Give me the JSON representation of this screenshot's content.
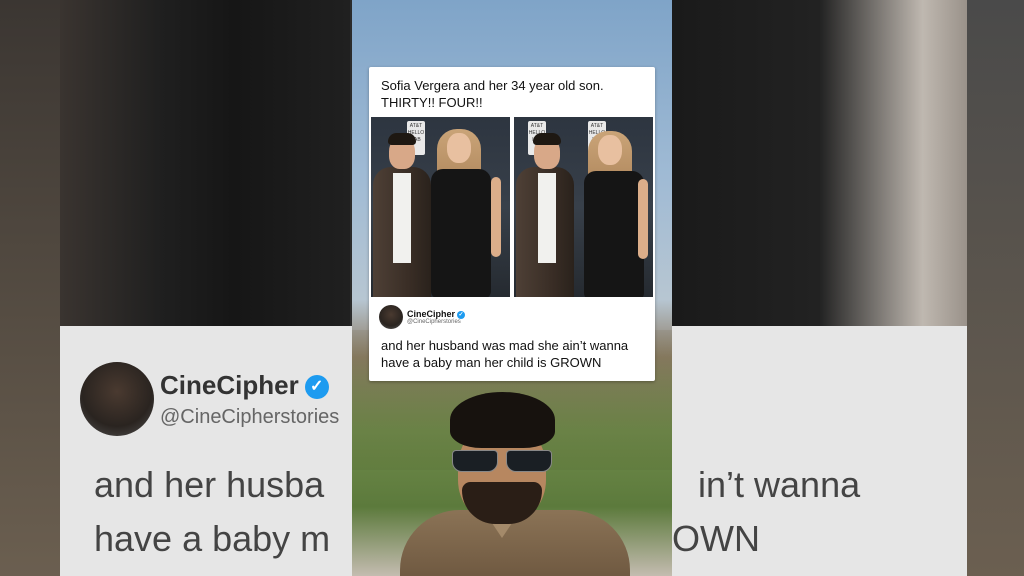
{
  "post": {
    "caption": "Sofia Vergera and her 34 year old son. THIRTY!! FOUR!!"
  },
  "reply": {
    "name": "CineCipher",
    "handle": "@CineCipherstories",
    "verified_glyph": "✓",
    "text": "and her husband was mad she ain’t wanna have a baby man her child is GROWN"
  },
  "background": {
    "left_text": "and her husba\nhave a baby m",
    "right_text": "in’t wanna\nOWN",
    "event_sign": "AT&T HELLO LAB"
  },
  "icons": {
    "verified": "verified-badge-icon",
    "avatar": "avatar-icon"
  },
  "colors": {
    "verified": "#1d9bf0",
    "card": "#ffffff",
    "sky": "#9fbad4"
  }
}
